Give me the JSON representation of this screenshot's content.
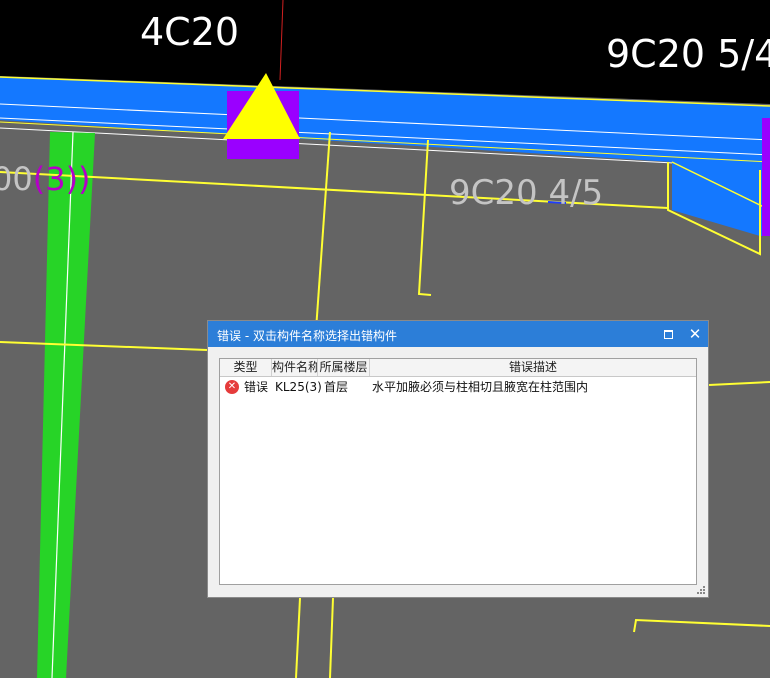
{
  "cad": {
    "labels": {
      "top_left": "4C20",
      "top_right": "9C20 5/4",
      "middle": "9C20 4/5",
      "left_partial": "00(3))"
    },
    "colors": {
      "background": "#646464",
      "beam_blue": "#1478ff",
      "line_yellow": "#ffff33",
      "column_green": "#27d427",
      "column_purple": "#9a00ff",
      "marker_yellow": "#ffff00"
    }
  },
  "dialog": {
    "title": "错误 - 双击构件名称选择出错构件",
    "maximize_icon": "maximize-icon",
    "close_glyph": "✕",
    "columns": [
      "类型",
      "构件名称",
      "所属楼层",
      "错误描述"
    ],
    "rows": [
      {
        "icon": "error-icon",
        "type": "错误",
        "name": "KL25(3)",
        "floor": "首层",
        "description": "水平加腋必须与柱相切且腋宽在柱范围内"
      }
    ]
  }
}
